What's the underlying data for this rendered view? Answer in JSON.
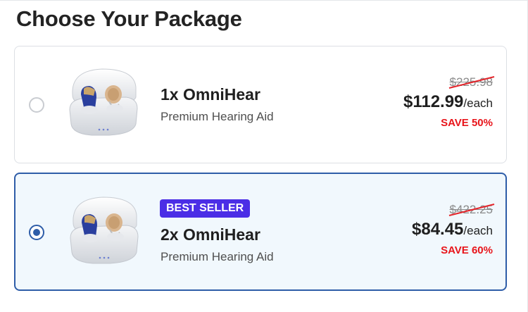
{
  "heading": "Choose Your Package",
  "packages": [
    {
      "name": "1x OmniHear",
      "subtitle": "Premium Hearing Aid",
      "old_price": "$225.98",
      "price": "$112.99",
      "per": "/each",
      "save": "SAVE 50%",
      "badge": "",
      "selected": false
    },
    {
      "name": "2x OmniHear",
      "subtitle": "Premium Hearing Aid",
      "old_price": "$422.25",
      "price": "$84.45",
      "per": "/each",
      "save": "SAVE 60%",
      "badge": "BEST SELLER",
      "selected": true
    }
  ],
  "colors": {
    "accent": "#2e5da8",
    "badge_bg": "#4b2ee6",
    "save_text": "#e8141a",
    "selected_bg": "#f1f8fd"
  },
  "icons": {
    "product": "hearing-aid-charging-case-image",
    "radio": "radio-button"
  }
}
